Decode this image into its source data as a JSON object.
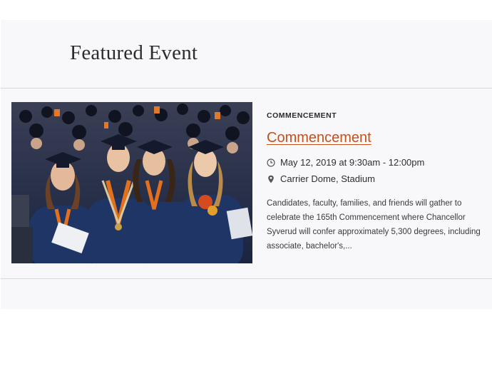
{
  "section": {
    "title": "Featured Event"
  },
  "event": {
    "category": "COMMENCEMENT",
    "title": "Commencement",
    "date_time": "May 12, 2019 at 9:30am - 12:00pm",
    "location": "Carrier Dome, Stadium",
    "description": "Candidates, faculty, families, and friends will gather to celebrate the 165th Commencement where Chancellor Syverud will confer approximately 5,300 degrees, including associate, bachelor's,...",
    "image_alt": "Graduates in caps and gowns smiling at commencement",
    "icons": {
      "date": "clock-icon",
      "location": "map-pin-icon"
    }
  },
  "colors": {
    "link": "#c4501a",
    "panel_bg": "#f8f8fa",
    "gown_navy": "#1f3566",
    "stole_orange": "#e2701c"
  }
}
